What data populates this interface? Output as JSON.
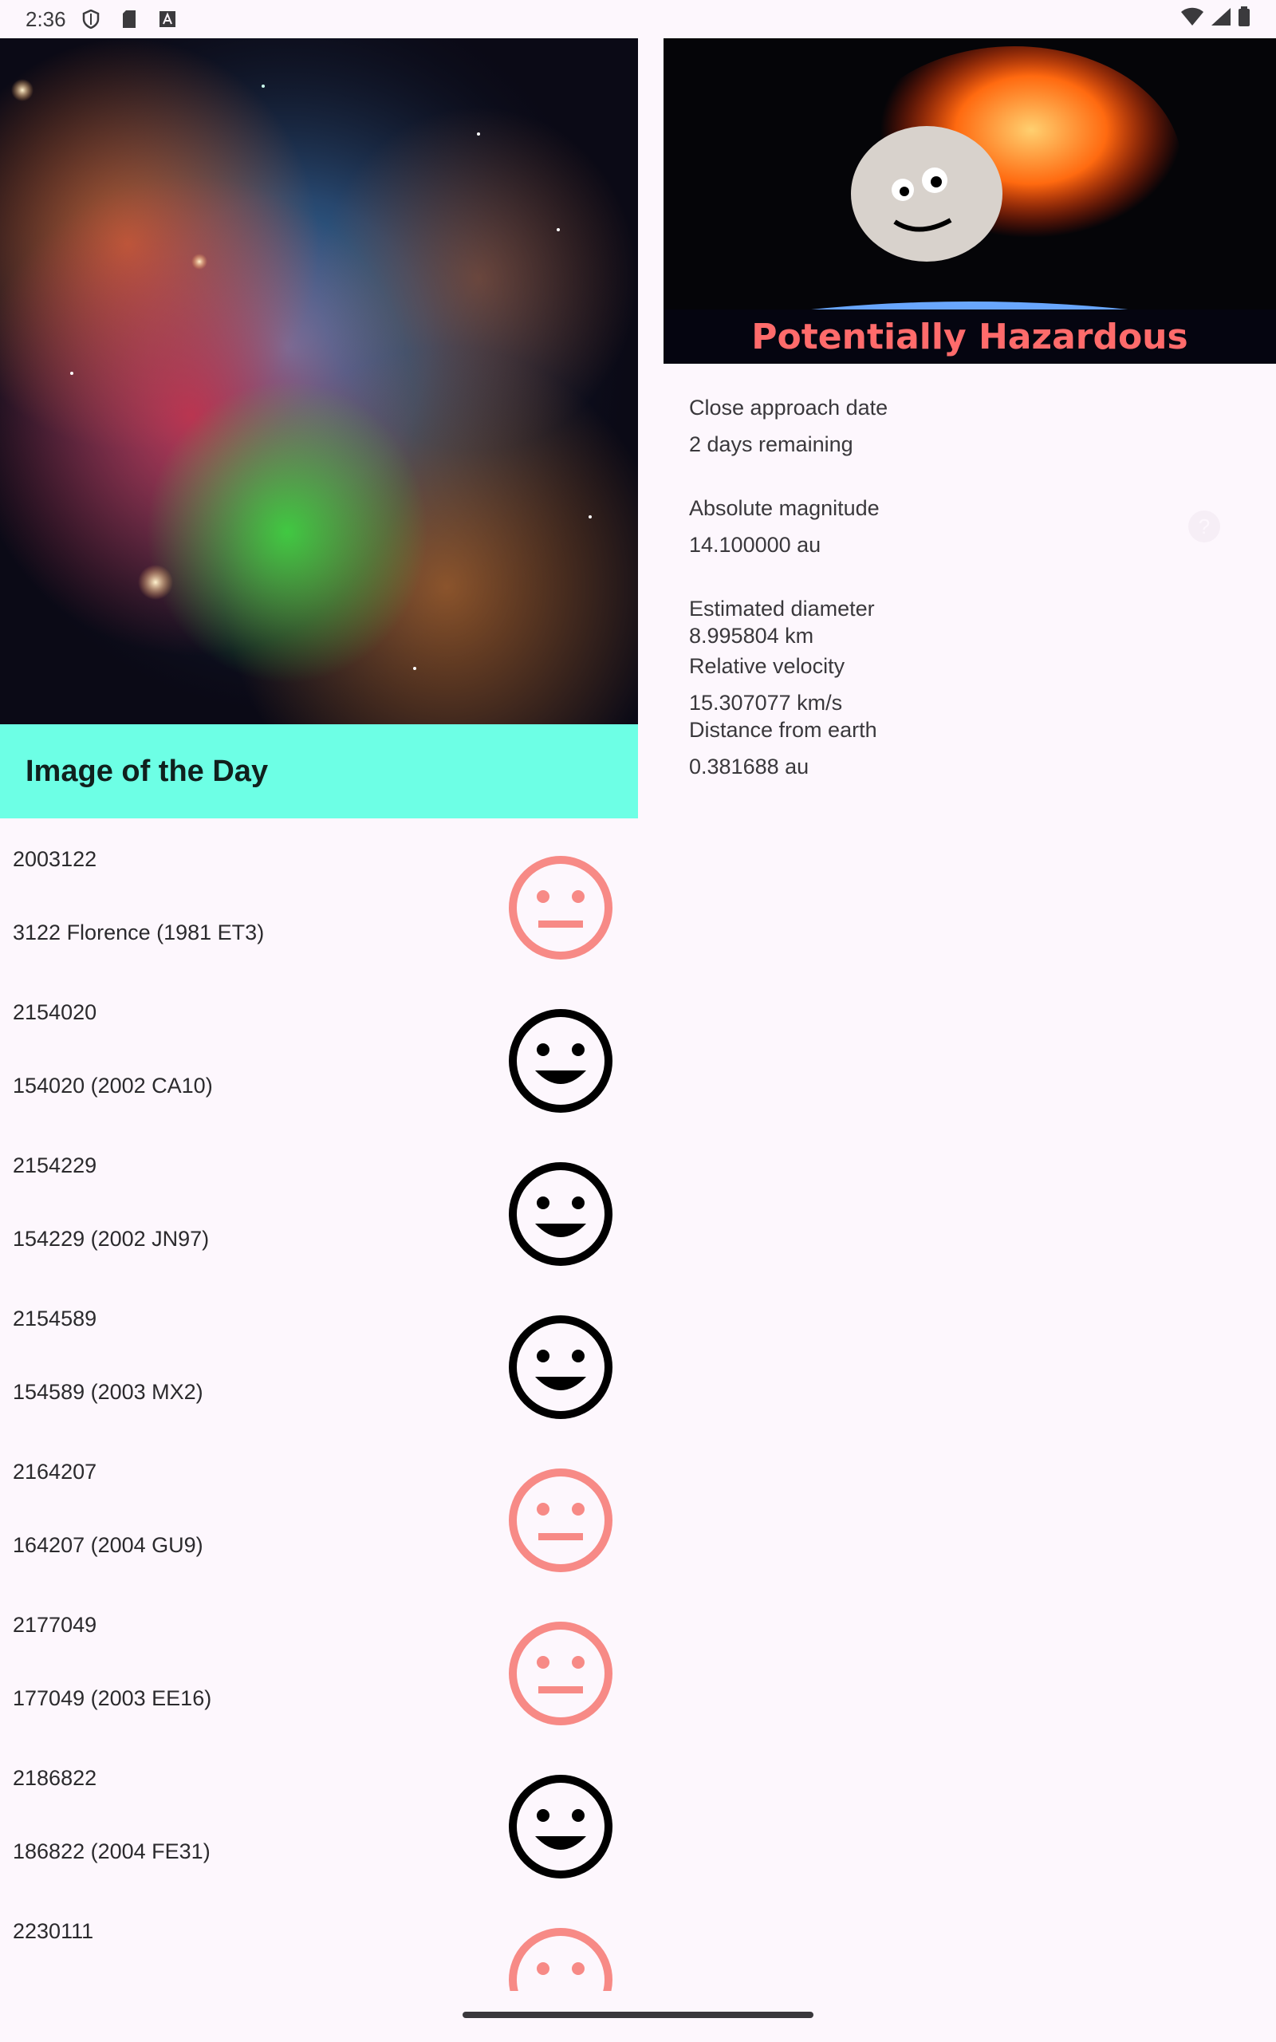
{
  "status_bar": {
    "time": "2:36",
    "icons": [
      "shield-icon",
      "sd-card-icon",
      "a-box-icon"
    ],
    "right_icons": [
      "wifi-icon",
      "cell-signal-icon",
      "battery-icon"
    ]
  },
  "image_of_day": {
    "title": "Image of the Day"
  },
  "asteroids": [
    {
      "id": "2003122",
      "name": "3122 Florence (1981 ET3)",
      "hazardous": true
    },
    {
      "id": "2154020",
      "name": "154020 (2002 CA10)",
      "hazardous": false
    },
    {
      "id": "2154229",
      "name": "154229 (2002 JN97)",
      "hazardous": false
    },
    {
      "id": "2154589",
      "name": "154589 (2003 MX2)",
      "hazardous": false
    },
    {
      "id": "2164207",
      "name": "164207 (2004 GU9)",
      "hazardous": true
    },
    {
      "id": "2177049",
      "name": "177049 (2003 EE16)",
      "hazardous": true
    },
    {
      "id": "2186822",
      "name": "186822 (2004 FE31)",
      "hazardous": false
    },
    {
      "id": "2230111",
      "name": "",
      "hazardous": true
    }
  ],
  "detail": {
    "banner_label": "Potentially Hazardous",
    "close_approach_label": "Close approach date",
    "close_approach_value": "2 days remaining",
    "abs_mag_label": "Absolute magnitude",
    "abs_mag_value": "14.100000 au",
    "diameter_label": "Estimated diameter",
    "diameter_value": "8.995804 km",
    "velocity_label": "Relative velocity",
    "velocity_value": "15.307077 km/s",
    "distance_label": "Distance from earth",
    "distance_value": "0.381688 au",
    "help_symbol": "?"
  },
  "colors": {
    "accent_teal": "#6dffe5",
    "hazard_face": "#f78a86",
    "safe_face": "#000000",
    "hazard_text": "#ff6b6b"
  }
}
